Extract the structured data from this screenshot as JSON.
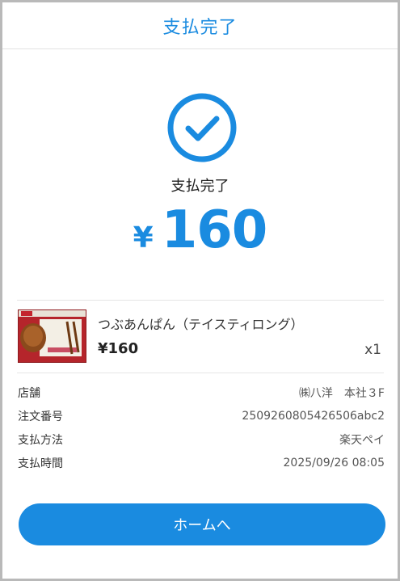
{
  "header": {
    "title": "支払完了"
  },
  "status": {
    "icon": "check-circle-icon",
    "text": "支払完了"
  },
  "payment": {
    "currency_symbol": "¥",
    "amount": "160"
  },
  "product": {
    "name": "つぶあんぱん（テイスティロング）",
    "price": "¥160",
    "quantity": "x1",
    "image": {
      "package_text": "つぶあんぱん",
      "brand": "ヤマザキ"
    }
  },
  "details": [
    {
      "label": "店舗",
      "value": "㈱八洋　本社３F"
    },
    {
      "label": "注文番号",
      "value": "2509260805426506abc2"
    },
    {
      "label": "支払方法",
      "value": "楽天ペイ"
    },
    {
      "label": "支払時間",
      "value": "2025/09/26 08:05"
    }
  ],
  "actions": {
    "home_label": "ホームへ"
  },
  "colors": {
    "accent": "#1a8be0",
    "product_package": "#b5252b"
  }
}
